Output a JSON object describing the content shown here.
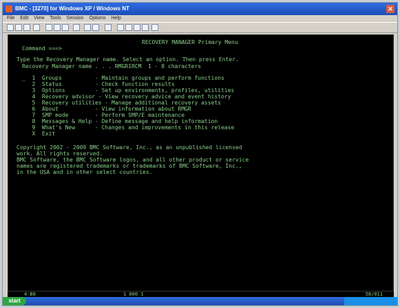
{
  "window": {
    "title": "BMC - [3270] for Windows XP / Windows NT",
    "close_glyph": "✕",
    "menu": [
      "File",
      "Edit",
      "View",
      "Tools",
      "Session",
      "Options",
      "Help"
    ]
  },
  "terminal": {
    "header": "RECOVERY MANAGER Primary Menu",
    "command_line": "Command ===>",
    "instruction": "Type the Recovery Manager name. Select an option. Then press Enter.",
    "name_prompt": "Recovery Manager name . . . RMGR1RCM  1 - 8 characters",
    "menu_items": [
      "_  1  Groups          - Maintain groups and perform functions",
      "   2  Status          - Check function results",
      "   3  Options         - Set up environments, profiles, utilities",
      "   4  Recovery advisor - View recovery advice and event history",
      "   5  Recovery utilities - Manage additional recovery assets",
      "   6  About           - View information about RMGR",
      "   7  SMP mode        - Perform SMP/E maintenance",
      "   8  Messages & Help - Define message and help information",
      "   9  What's New      - Changes and improvements in this release",
      "   X  Exit"
    ],
    "copyright_lines": [
      "Copyright 2002 - 2009 BMC Software, Inc., as an unpublished licensed",
      "work. All rights reserved.",
      "BMC Software, the BMC Software logos, and all other product or service",
      "names are registered trademarks or trademarks of BMC Software, Inc.,",
      "in the USA and in other select countries."
    ]
  },
  "status_bar": {
    "left": "4-B8",
    "middle": "1 000  1",
    "right": "58/011"
  },
  "taskbar": {
    "start": "start"
  }
}
